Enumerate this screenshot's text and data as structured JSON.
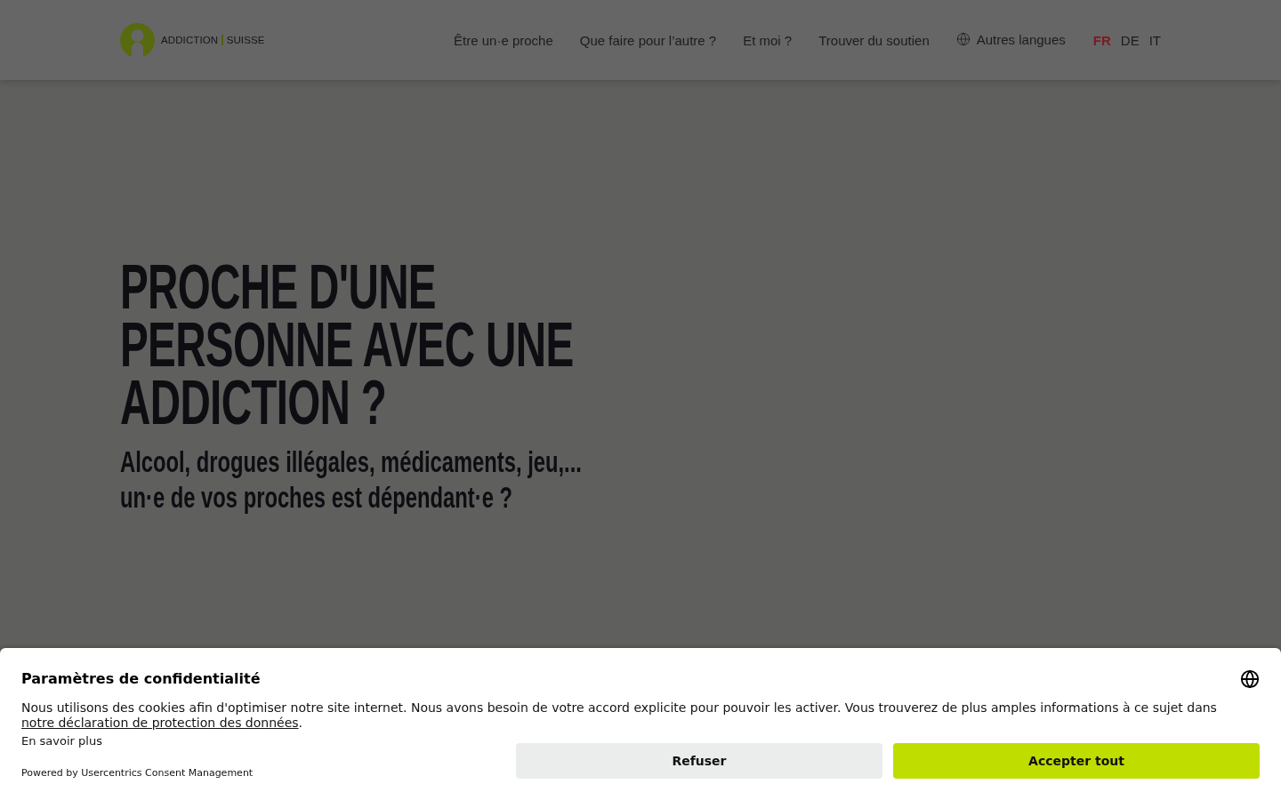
{
  "header": {
    "logo": {
      "words": [
        "ADDICTION",
        "SUISSE"
      ]
    },
    "nav": [
      {
        "label": "Être un·e proche"
      },
      {
        "label": "Que faire pour l’autre ?"
      },
      {
        "label": "Et moi ?"
      },
      {
        "label": "Trouver du soutien"
      }
    ],
    "other_languages": {
      "label": "Autres langues"
    },
    "languages": [
      {
        "label": "FR",
        "selected": true
      },
      {
        "label": "DE",
        "selected": false
      },
      {
        "label": "IT",
        "selected": false
      }
    ]
  },
  "hero": {
    "title": "PROCHE D'UNE PERSONNE AVEC UNE ADDICTION ?",
    "subtitle": "Alcool, drogues illégales, médicaments, jeu,... un·e de vos proches est dépendant·e ?"
  },
  "consent_banner": {
    "title": "Paramètres de confidentialité",
    "text": "Nous utilisons des cookies afin d'optimiser notre site internet. Nous avons besoin de votre accord explicite pour pouvoir les activer. Vous trouverez de plus amples informations à ce sujet dans",
    "link": "notre déclaration de protection des données",
    "text_end": ".",
    "more_link": "En savoir plus",
    "powered_by": "Powered by Usercentrics Consent Management",
    "buttons": [
      {
        "label": "Refuser",
        "kind": "secondary"
      },
      {
        "label": "Accepter tout",
        "kind": "primary"
      }
    ]
  }
}
